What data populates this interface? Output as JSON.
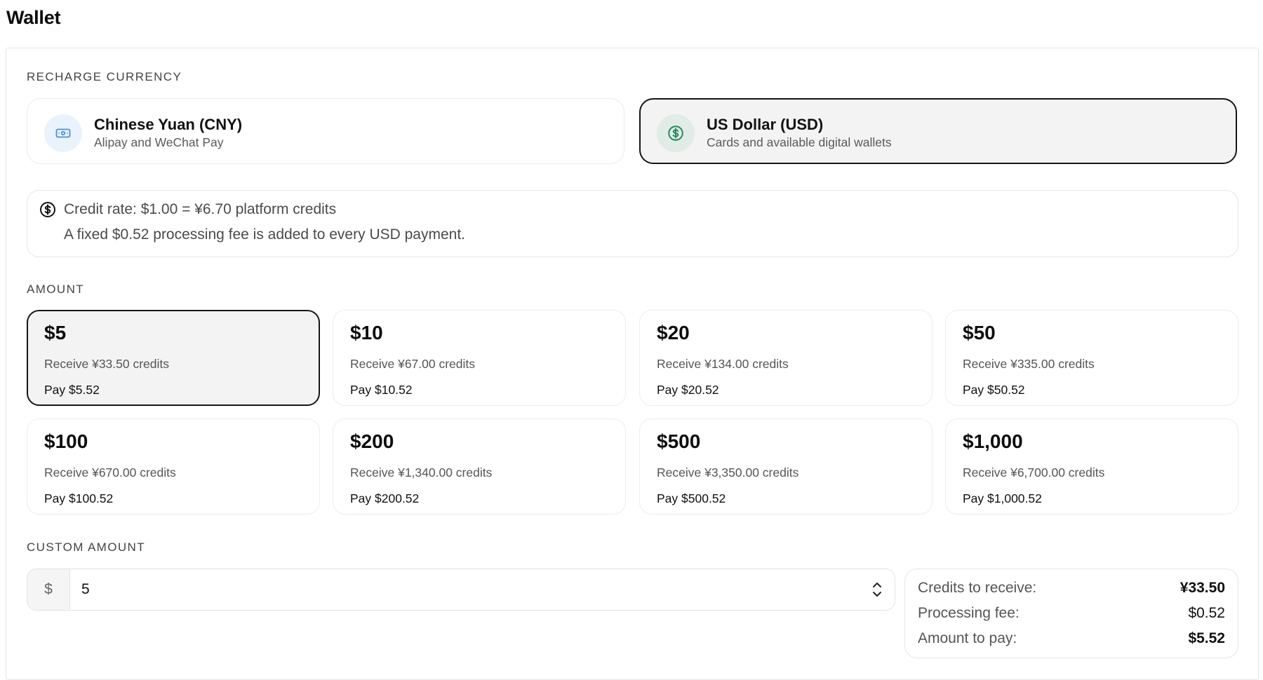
{
  "page": {
    "title": "Wallet"
  },
  "recharge": {
    "label": "RECHARGE CURRENCY",
    "options": [
      {
        "name": "Chinese Yuan (CNY)",
        "subtitle": "Alipay and WeChat Pay",
        "icon": "banknote-icon",
        "selected": false
      },
      {
        "name": "US Dollar (USD)",
        "subtitle": "Cards and available digital wallets",
        "icon": "dollar-circle-icon",
        "selected": true
      }
    ]
  },
  "info": {
    "icon": "dollar-circle-icon",
    "line1": "Credit rate: $1.00 = ¥6.70 platform credits",
    "line2": "A fixed $0.52 processing fee is added to every USD payment."
  },
  "amount": {
    "label": "AMOUNT",
    "options": [
      {
        "value": "$5",
        "receive": "Receive ¥33.50 credits",
        "pay": "Pay $5.52",
        "selected": true
      },
      {
        "value": "$10",
        "receive": "Receive ¥67.00 credits",
        "pay": "Pay $10.52",
        "selected": false
      },
      {
        "value": "$20",
        "receive": "Receive ¥134.00 credits",
        "pay": "Pay $20.52",
        "selected": false
      },
      {
        "value": "$50",
        "receive": "Receive ¥335.00 credits",
        "pay": "Pay $50.52",
        "selected": false
      },
      {
        "value": "$100",
        "receive": "Receive ¥670.00 credits",
        "pay": "Pay $100.52",
        "selected": false
      },
      {
        "value": "$200",
        "receive": "Receive ¥1,340.00 credits",
        "pay": "Pay $200.52",
        "selected": false
      },
      {
        "value": "$500",
        "receive": "Receive ¥3,350.00 credits",
        "pay": "Pay $500.52",
        "selected": false
      },
      {
        "value": "$1,000",
        "receive": "Receive ¥6,700.00 credits",
        "pay": "Pay $1,000.52",
        "selected": false
      }
    ]
  },
  "custom": {
    "label": "CUSTOM AMOUNT",
    "prefix": "$",
    "value": "5"
  },
  "summary": {
    "credits_label": "Credits to receive:",
    "credits_value": "¥33.50",
    "fee_label": "Processing fee:",
    "fee_value": "$0.52",
    "pay_label": "Amount to pay:",
    "pay_value": "$5.52"
  },
  "colors": {
    "selected_border": "#161616",
    "selected_bg": "#f3f3f3",
    "cny_icon": "#4a90d9",
    "usd_icon": "#1f8a5b"
  }
}
